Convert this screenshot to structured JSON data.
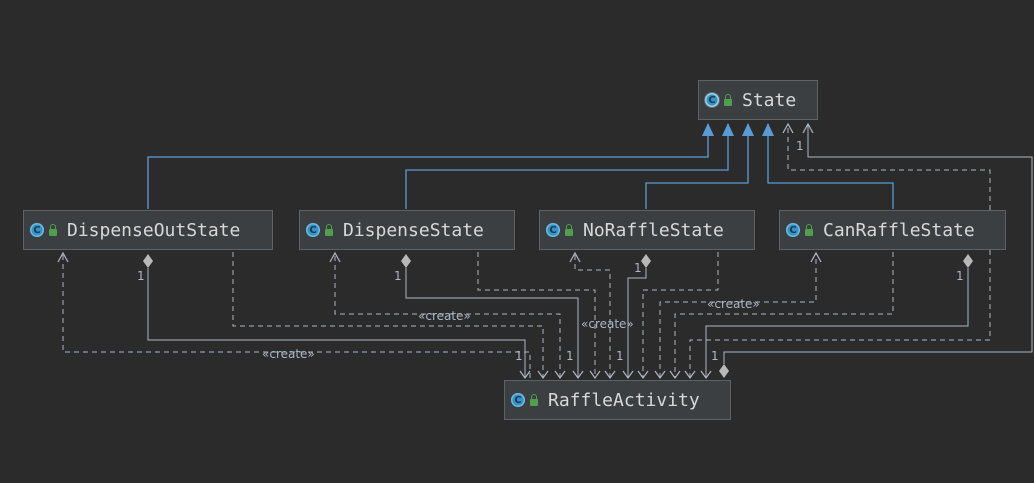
{
  "classes": {
    "state": "State",
    "dispense_out_state": "DispenseOutState",
    "dispense_state": "DispenseState",
    "no_raffle_state": "NoRaffleState",
    "can_raffle_state": "CanRaffleState",
    "raffle_activity": "RaffleActivity"
  },
  "icons": {
    "class_icon": "c-class-icon",
    "abstract_class_icon": "c-abstract-class-icon",
    "visibility_icon": "public-lock-icon"
  },
  "labels": {
    "create": "«create»",
    "multiplicity_one": "1"
  },
  "colors": {
    "background": "#2b2b2b",
    "node_fill": "#3c3f41",
    "inheritance": "#5b9bd5",
    "dependency": "#a9b7c6",
    "class_icon": "#3592c4"
  }
}
